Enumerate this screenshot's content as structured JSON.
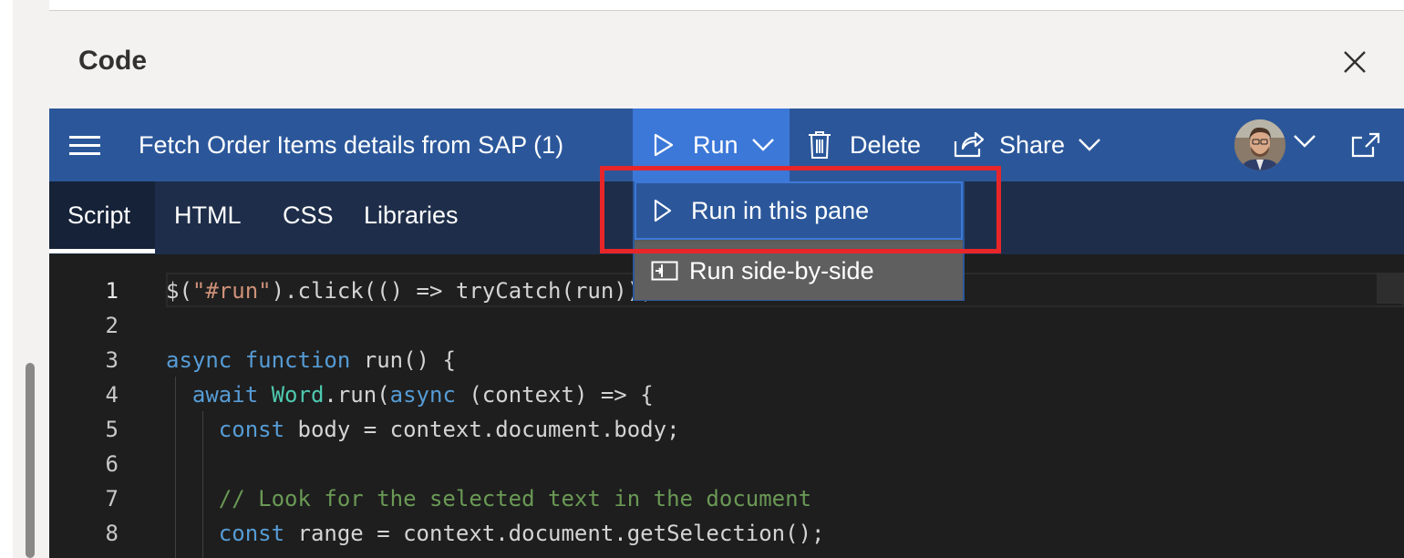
{
  "pane": {
    "title": "Code"
  },
  "toolbar": {
    "snippet_title": "Fetch Order Items details from SAP (1)",
    "run_label": "Run",
    "delete_label": "Delete",
    "share_label": "Share",
    "accent_color": "#2b579a"
  },
  "tabs": [
    {
      "label": "Script"
    },
    {
      "label": "HTML"
    },
    {
      "label": "CSS"
    },
    {
      "label": "Libraries"
    }
  ],
  "run_menu": {
    "items": [
      {
        "label": "Run in this pane",
        "icon": "play-icon"
      },
      {
        "label": "Run side-by-side",
        "icon": "side-by-side-icon"
      }
    ]
  },
  "editor": {
    "line_numbers": [
      "1",
      "2",
      "3",
      "4",
      "5",
      "6",
      "7",
      "8"
    ],
    "lines": [
      "$(\"#run\").click(() => tryCatch(run));",
      "",
      "async function run() {",
      "  await Word.run(async (context) => {",
      "    const body = context.document.body;",
      "",
      "    // Look for the selected text in the document",
      "    const range = context.document.getSelection();"
    ]
  },
  "annotation": {
    "color": "#e8262a"
  }
}
